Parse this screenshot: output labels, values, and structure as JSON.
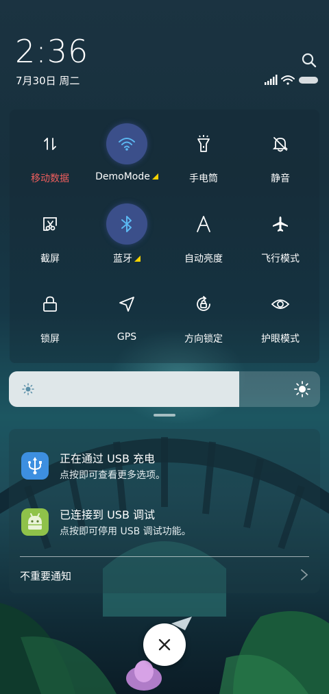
{
  "status": {
    "time": "2:36",
    "date": "7月30日 周二"
  },
  "tiles": [
    {
      "label": "移动数据",
      "icon": "mobile-data-icon",
      "active": false,
      "alert": true
    },
    {
      "label": "DemoMode",
      "icon": "wifi-icon",
      "active": true,
      "expand": true
    },
    {
      "label": "手电筒",
      "icon": "flashlight-icon",
      "active": false
    },
    {
      "label": "静音",
      "icon": "mute-bell-icon",
      "active": false
    },
    {
      "label": "截屏",
      "icon": "screenshot-icon",
      "active": false
    },
    {
      "label": "蓝牙",
      "icon": "bluetooth-icon",
      "active": true,
      "expand": true
    },
    {
      "label": "自动亮度",
      "icon": "auto-brightness-icon",
      "active": false
    },
    {
      "label": "飞行模式",
      "icon": "airplane-icon",
      "active": false
    },
    {
      "label": "锁屏",
      "icon": "lock-icon",
      "active": false
    },
    {
      "label": "GPS",
      "icon": "gps-icon",
      "active": false
    },
    {
      "label": "方向锁定",
      "icon": "rotation-lock-icon",
      "active": false
    },
    {
      "label": "护眼模式",
      "icon": "eye-icon",
      "active": false
    }
  ],
  "brightness": {
    "level_fraction": 0.74
  },
  "notifications": [
    {
      "title": "正在通过 USB 充电",
      "subtitle": "点按即可查看更多选项。",
      "icon": "usb-icon",
      "icon_color": "#3d8fe0"
    },
    {
      "title": "已连接到 USB 调试",
      "subtitle": "点按即可停用 USB 调试功能。",
      "icon": "android-icon",
      "icon_color": "#8fc24a"
    }
  ],
  "minor_notifications": {
    "label": "不重要通知"
  },
  "colors": {
    "active_tile": "#3b4f8a",
    "alert_label": "#ef5e5e",
    "expand_triangle": "#f5d200"
  }
}
